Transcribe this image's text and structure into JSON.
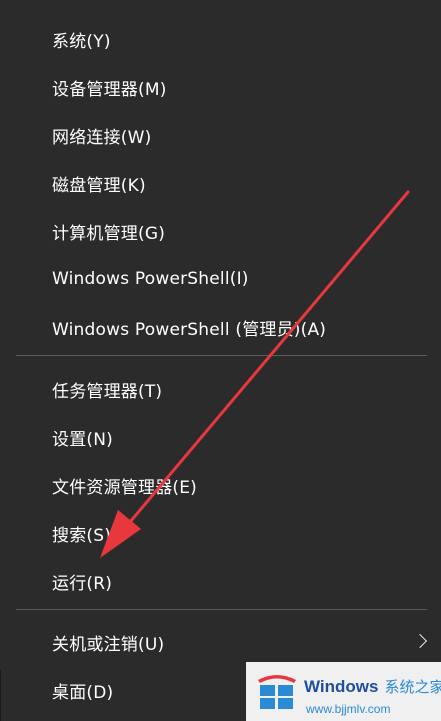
{
  "menu": {
    "items": [
      {
        "label": "系统(Y)"
      },
      {
        "label": "设备管理器(M)"
      },
      {
        "label": "网络连接(W)"
      },
      {
        "label": "磁盘管理(K)"
      },
      {
        "label": "计算机管理(G)"
      },
      {
        "label": "Windows PowerShell(I)"
      },
      {
        "label": "Windows PowerShell (管理员)(A)"
      },
      {
        "label": "任务管理器(T)"
      },
      {
        "label": "设置(N)"
      },
      {
        "label": "文件资源管理器(E)"
      },
      {
        "label": "搜索(S)"
      },
      {
        "label": "运行(R)"
      },
      {
        "label": "关机或注销(U)"
      },
      {
        "label": "桌面(D)"
      }
    ]
  },
  "annotation": {
    "color": "#e8383d"
  },
  "watermark": {
    "brand": "Windows",
    "brand_cn": "系统之家",
    "url": "www.bjjmlv.com"
  }
}
